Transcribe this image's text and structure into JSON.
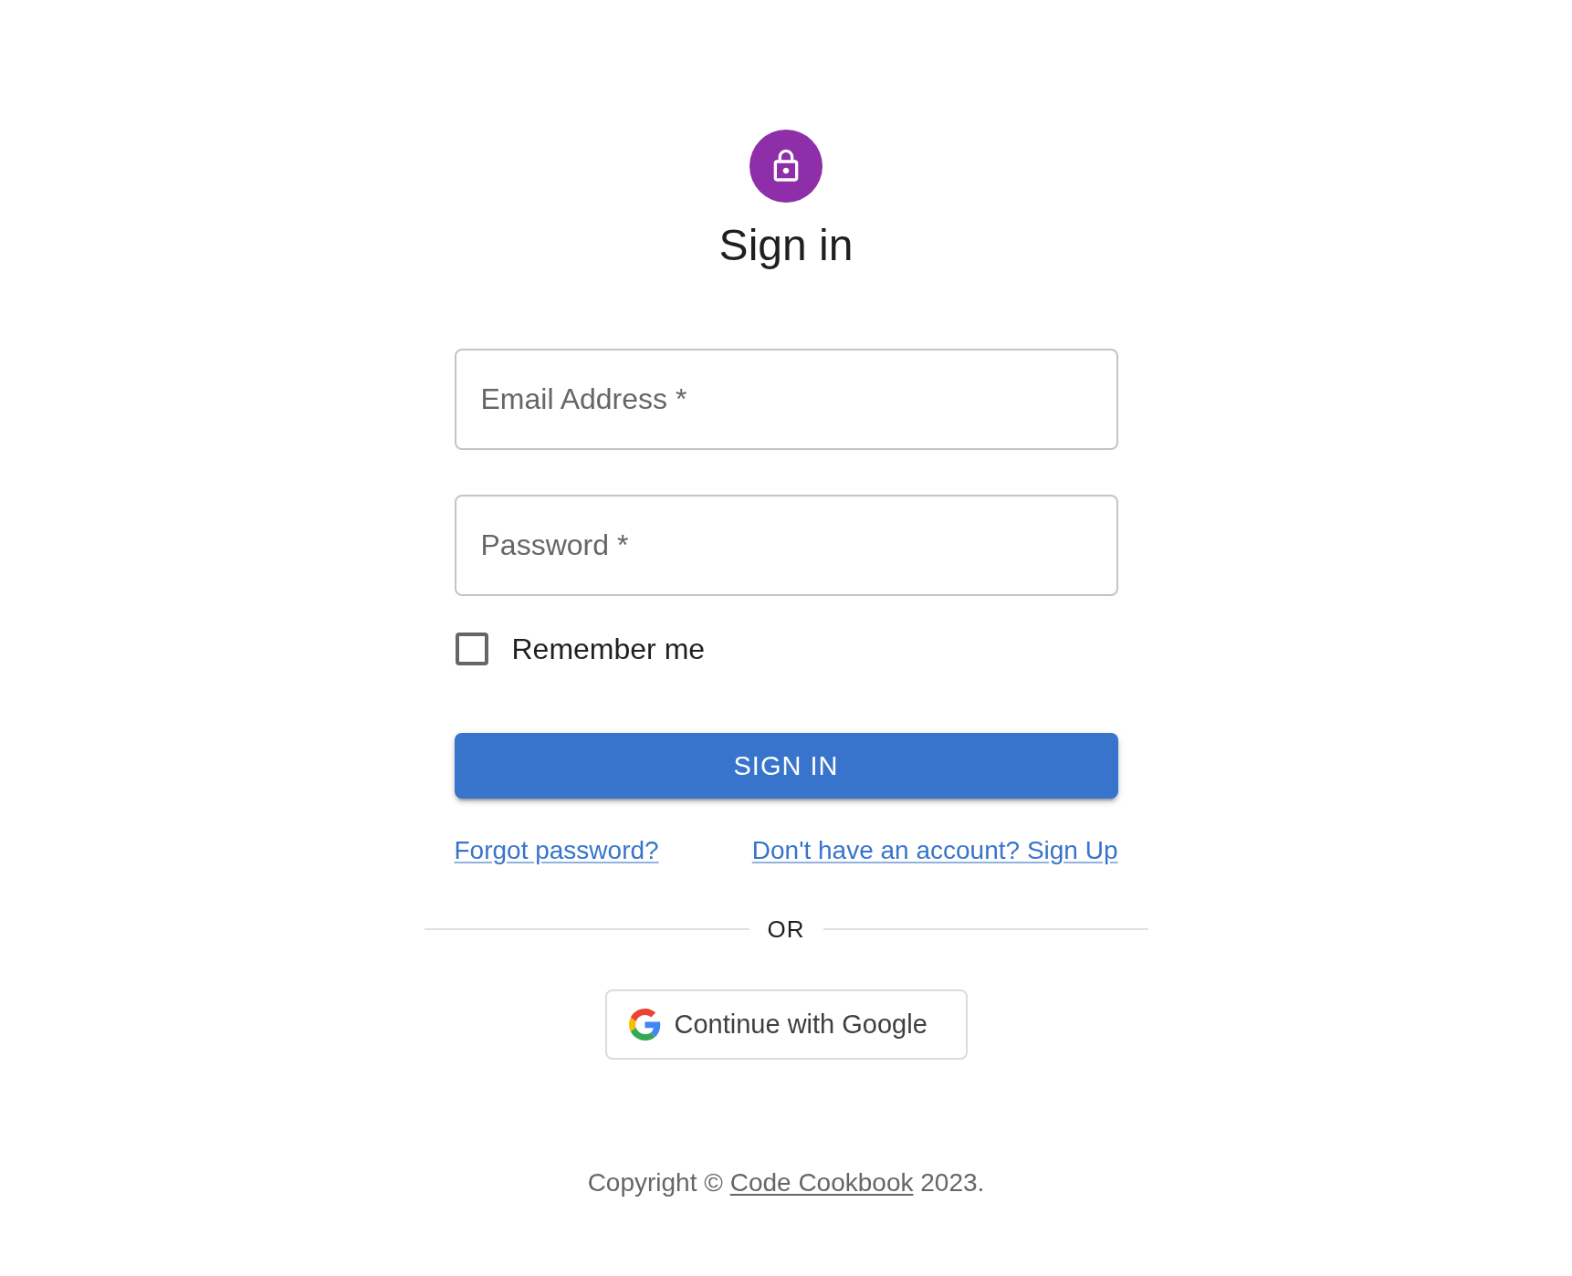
{
  "title": "Sign in",
  "fields": [
    {
      "placeholder": "Email Address *"
    },
    {
      "placeholder": "Password *"
    }
  ],
  "remember": {
    "label": "Remember me",
    "checked": false
  },
  "submit_button": {
    "label": "SIGN IN"
  },
  "links": [
    "Forgot password?",
    "Don't have an account? Sign Up"
  ],
  "divider": {
    "label": "OR"
  },
  "google_button": {
    "label": "Continue with Google"
  },
  "footer": {
    "prefix": "Copyright ©",
    "link": "Code Cookbook",
    "suffix": "2023."
  }
}
